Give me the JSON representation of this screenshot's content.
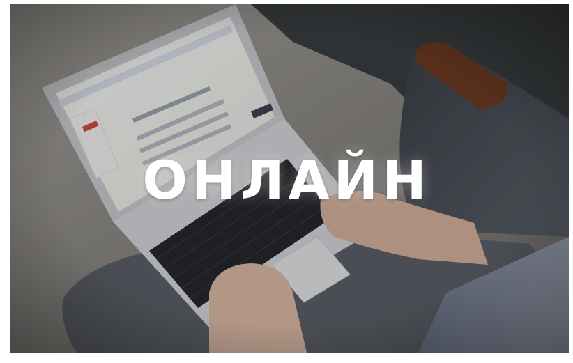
{
  "photo": {
    "subject": "person-typing-on-laptop",
    "overlay_text": "ОНЛАЙН"
  },
  "colors": {
    "floor": "#8a8884",
    "couch": "#4a4f56",
    "laptop_body": "#dcdde0",
    "keyboard": "#2a2c30",
    "screen": "#f4f4f2",
    "armrest_wood": "#6b3a22",
    "shirt": "#7f879a",
    "skin": "#d9b8a4",
    "headline": "#ffffff"
  }
}
